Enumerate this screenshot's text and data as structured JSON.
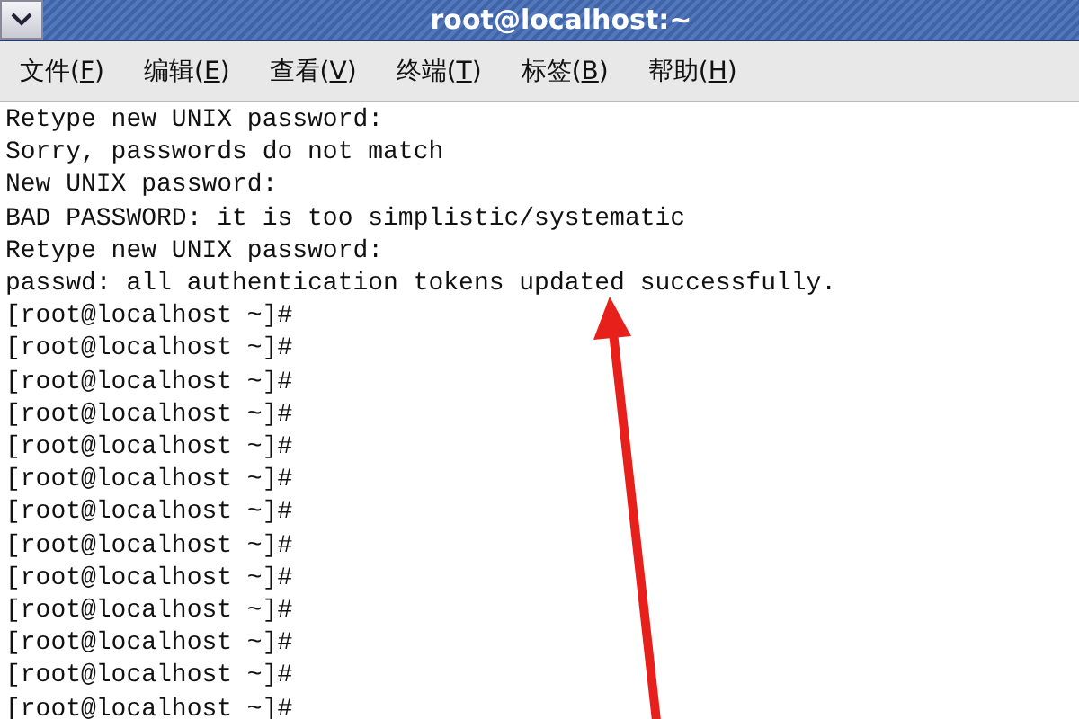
{
  "window": {
    "title": "root@localhost:~"
  },
  "menu": [
    {
      "label_parts": [
        "文件(",
        "F",
        ")"
      ]
    },
    {
      "label_parts": [
        "编辑(",
        "E",
        ")"
      ]
    },
    {
      "label_parts": [
        "查看(",
        "V",
        ")"
      ]
    },
    {
      "label_parts": [
        "终端(",
        "T",
        ")"
      ]
    },
    {
      "label_parts": [
        "标签(",
        "B",
        ")"
      ]
    },
    {
      "label_parts": [
        "帮助(",
        "H",
        ")"
      ]
    }
  ],
  "terminal": {
    "lines": [
      "Retype new UNIX password:",
      "Sorry, passwords do not match",
      "New UNIX password:",
      "BAD PASSWORD: it is too simplistic/systematic",
      "Retype new UNIX password:",
      "passwd: all authentication tokens updated successfully.",
      "[root@localhost ~]#",
      "[root@localhost ~]#",
      "[root@localhost ~]#",
      "[root@localhost ~]#",
      "[root@localhost ~]#",
      "[root@localhost ~]#",
      "[root@localhost ~]#",
      "[root@localhost ~]#",
      "[root@localhost ~]#",
      "[root@localhost ~]#",
      "[root@localhost ~]#",
      "[root@localhost ~]#",
      "[root@localhost ~]#"
    ]
  }
}
